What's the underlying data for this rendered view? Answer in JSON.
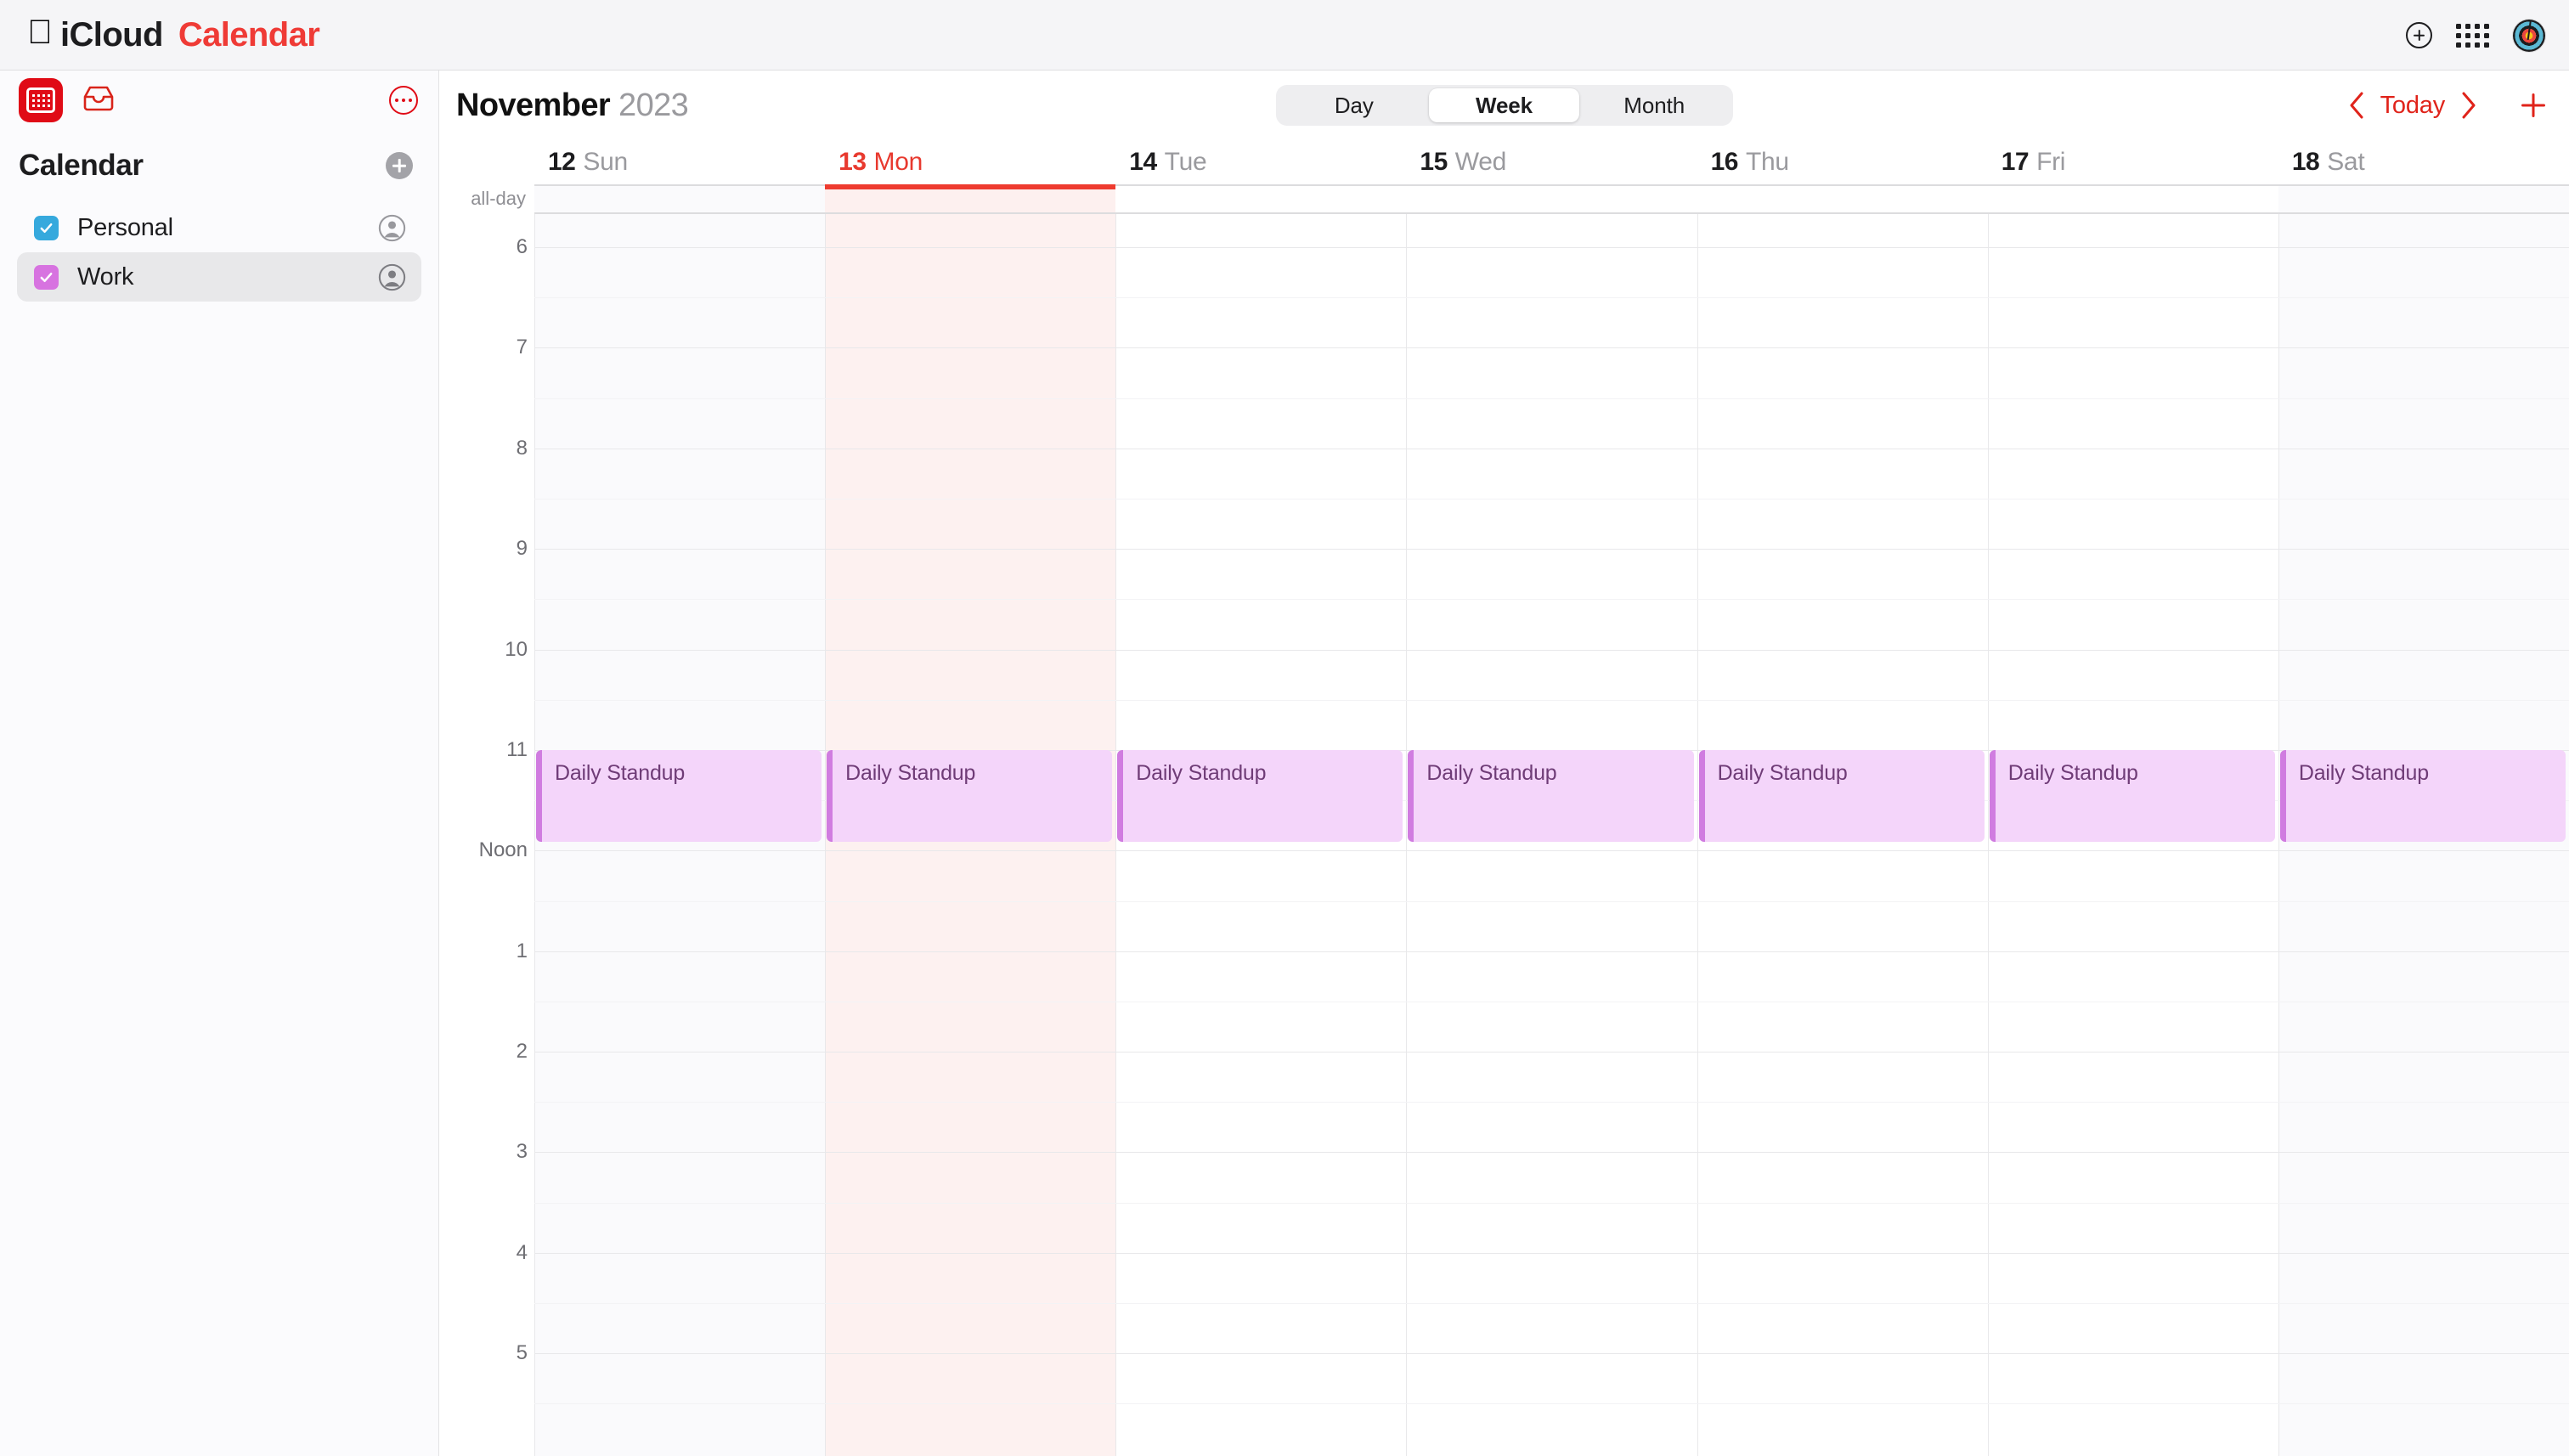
{
  "topbar": {
    "brand_icloud": "iCloud",
    "brand_app": "Calendar",
    "apple_logo": "",
    "icons": {
      "add": "plus-circle-icon",
      "apps": "app-grid-icon",
      "avatar": "account-avatar"
    }
  },
  "sidebar": {
    "app_icon": "calendar-app-icon",
    "inbox_icon": "inbox-icon",
    "more_icon": "more-options-icon",
    "title": "Calendar",
    "add_calendar_icon": "add-calendar-icon",
    "calendars": [
      {
        "name": "Personal",
        "color": "#36a9dd",
        "checked": true,
        "selected": false,
        "share_icon": "person-circle-icon"
      },
      {
        "name": "Work",
        "color": "#d773e0",
        "checked": true,
        "selected": true,
        "share_icon": "person-circle-icon"
      }
    ]
  },
  "main": {
    "month": "November",
    "year": "2023",
    "view_tabs": [
      {
        "label": "Day",
        "active": false
      },
      {
        "label": "Week",
        "active": true
      },
      {
        "label": "Month",
        "active": false
      }
    ],
    "nav": {
      "prev_icon": "chevron-left-icon",
      "today_label": "Today",
      "next_icon": "chevron-right-icon",
      "new_event_icon": "plus-icon"
    },
    "accent_red": "#e0231a",
    "today_highlight": "#fdf1f0"
  },
  "calendar": {
    "allday_label": "all-day",
    "days": [
      {
        "num": "12",
        "name": "Sun",
        "today": false,
        "weekend": true
      },
      {
        "num": "13",
        "name": "Mon",
        "today": true,
        "weekend": false
      },
      {
        "num": "14",
        "name": "Tue",
        "today": false,
        "weekend": false
      },
      {
        "num": "15",
        "name": "Wed",
        "today": false,
        "weekend": false
      },
      {
        "num": "16",
        "name": "Thu",
        "today": false,
        "weekend": false
      },
      {
        "num": "17",
        "name": "Fri",
        "today": false,
        "weekend": false
      },
      {
        "num": "18",
        "name": "Sat",
        "today": false,
        "weekend": true
      }
    ],
    "time_labels": [
      "6",
      "7",
      "8",
      "9",
      "10",
      "11",
      "Noon",
      "1",
      "2",
      "3",
      "4",
      "5"
    ],
    "first_hour": 6,
    "last_hour": 17,
    "events": [
      {
        "title": "Daily Standup",
        "day": 0,
        "start": "11:00",
        "end": "11:55",
        "calendar": "Work"
      },
      {
        "title": "Daily Standup",
        "day": 1,
        "start": "11:00",
        "end": "11:55",
        "calendar": "Work"
      },
      {
        "title": "Daily Standup",
        "day": 2,
        "start": "11:00",
        "end": "11:55",
        "calendar": "Work"
      },
      {
        "title": "Daily Standup",
        "day": 3,
        "start": "11:00",
        "end": "11:55",
        "calendar": "Work"
      },
      {
        "title": "Daily Standup",
        "day": 4,
        "start": "11:00",
        "end": "11:55",
        "calendar": "Work"
      },
      {
        "title": "Daily Standup",
        "day": 5,
        "start": "11:00",
        "end": "11:55",
        "calendar": "Work"
      },
      {
        "title": "Daily Standup",
        "day": 6,
        "start": "11:00",
        "end": "11:55",
        "calendar": "Work"
      }
    ],
    "event_fill": "#f4d5fa",
    "event_bar": "#d07ce0",
    "event_text": "#6f3c77"
  }
}
